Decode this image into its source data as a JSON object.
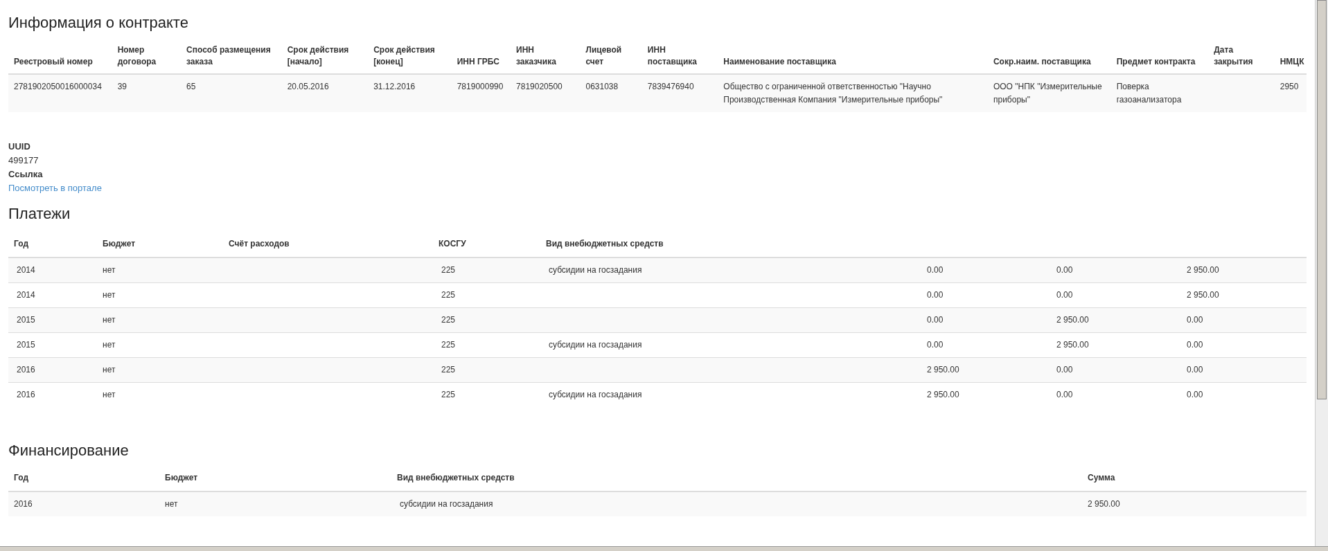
{
  "contract": {
    "title": "Информация о контракте",
    "columns": [
      "Реестровый номер",
      "Номер договора",
      "Способ размещения заказа",
      "Срок действия [начало]",
      "Срок действия [конец]",
      "ИНН ГРБС",
      "ИНН заказчика",
      "Лицевой счет",
      "ИНН поставщика",
      "Наименование поставщика",
      "Сокр.наим. поставщика",
      "Предмет контракта",
      "Дата закрытия",
      "НМЦК"
    ],
    "rows": [
      [
        "2781902050016000034",
        "39",
        "65",
        "20.05.2016",
        "31.12.2016",
        "7819000990",
        "7819020500",
        "0631038",
        "7839476940",
        "Общество с ограниченной ответственностью \"Научно Производственная Компания \"Измерительные приборы\"",
        "ООО \"НПК \"Измерительные приборы\"",
        "Поверка газоанализатора",
        "",
        "2950"
      ]
    ]
  },
  "details": [
    {
      "label": "UUID",
      "value": "499177",
      "kind": "text"
    },
    {
      "label": "Ссылка",
      "value": "Посмотреть в портале",
      "kind": "link"
    }
  ],
  "payments": {
    "title": "Платежи",
    "columns": [
      "Год",
      "Бюджет",
      "Счёт расходов",
      "КОСГУ",
      "Вид внебюджетных средств"
    ],
    "rows": [
      {
        "year": "2014",
        "budget": "нет",
        "kosgu": "225",
        "offbudget_type": "субсидии на госзадания",
        "column_6": "0.00",
        "column_7": "0.00",
        "column_8": "2 950.00"
      },
      {
        "year": "2014",
        "budget": "нет",
        "kosgu": "225",
        "column_6": "0.00",
        "column_7": "0.00",
        "column_8": "2 950.00"
      },
      {
        "year": "2015",
        "budget": "нет",
        "kosgu": "225",
        "column_6": "0.00",
        "column_7": "2 950.00",
        "column_8": "0.00"
      },
      {
        "year": "2015",
        "budget": "нет",
        "kosgu": "225",
        "offbudget_type": "субсидии на госзадания",
        "column_6": "0.00",
        "column_7": "2 950.00",
        "column_8": "0.00"
      },
      {
        "year": "2016",
        "budget": "нет",
        "kosgu": "225",
        "column_6": "2 950.00",
        "column_7": "0.00",
        "column_8": "0.00"
      },
      {
        "year": "2016",
        "budget": "нет",
        "kosgu": "225",
        "offbudget_type": "субсидии на госзадания",
        "column_6": "2 950.00",
        "column_7": "0.00",
        "column_8": "0.00"
      }
    ]
  },
  "financing": {
    "title": "Финансирование",
    "columns": [
      "Год",
      "Бюджет",
      "Вид внебюджетных средств",
      "Сумма"
    ],
    "rows": [
      {
        "year": "2016",
        "budget": "нет",
        "offbudget_type": "субсидии на госзадания",
        "sum": "2 950.00"
      }
    ]
  }
}
